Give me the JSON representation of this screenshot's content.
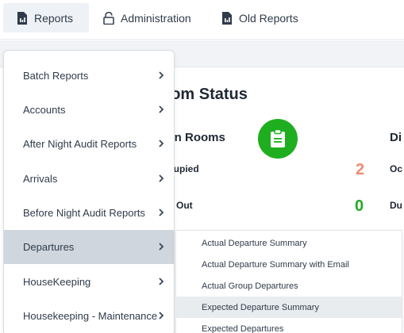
{
  "nav": {
    "tabs": [
      {
        "label": "Reports",
        "icon": "report-file-icon",
        "active": true
      },
      {
        "label": "Administration",
        "icon": "lock-icon",
        "active": false
      },
      {
        "label": "Old Reports",
        "icon": "report-file-icon",
        "active": false
      }
    ]
  },
  "background": {
    "section_title": "oom Status",
    "card_title": "ean Rooms",
    "card_icon": "clipboard-icon",
    "next_card_title": "Di",
    "rows": [
      {
        "label": "cupied",
        "value": "2",
        "color": "#f08a6f"
      },
      {
        "label": "e Out",
        "value": "0",
        "color": "#22aa22"
      }
    ],
    "next_card_rows": [
      "Oc",
      "Du"
    ]
  },
  "menu": {
    "items": [
      {
        "label": "Batch Reports"
      },
      {
        "label": "Accounts"
      },
      {
        "label": "After Night Audit Reports"
      },
      {
        "label": "Arrivals"
      },
      {
        "label": "Before Night Audit Reports"
      },
      {
        "label": "Departures",
        "active": true
      },
      {
        "label": "HouseKeeping"
      },
      {
        "label": "Housekeeping - Maintenance"
      }
    ]
  },
  "submenu": {
    "items": [
      {
        "label": "Actual Departure Summary"
      },
      {
        "label": "Actual Departure Summary with Email"
      },
      {
        "label": "Actual Group Departures"
      },
      {
        "label": "Expected Departure Summary",
        "active": true
      },
      {
        "label": "Expected Departures"
      }
    ]
  },
  "colors": {
    "accent_green": "#1fae1f",
    "active_menu": "#cfd6dd"
  }
}
